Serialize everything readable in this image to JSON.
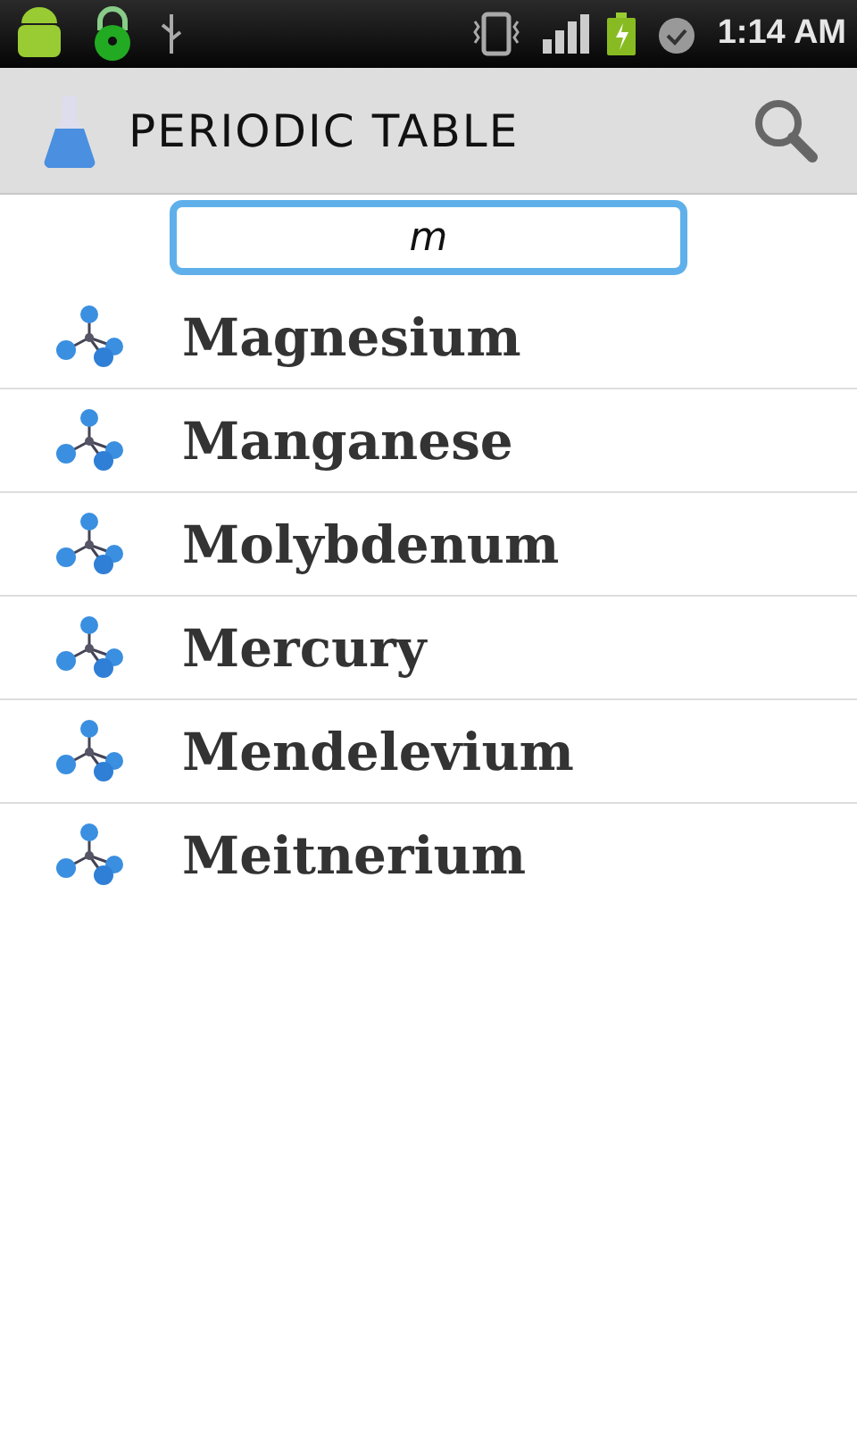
{
  "status_bar": {
    "time": "1:14 AM"
  },
  "app_bar": {
    "title": "PERIODIC TABLE"
  },
  "search": {
    "value": "m"
  },
  "elements": [
    {
      "name": "Magnesium"
    },
    {
      "name": "Manganese"
    },
    {
      "name": "Molybdenum"
    },
    {
      "name": "Mercury"
    },
    {
      "name": "Mendelevium"
    },
    {
      "name": "Meitnerium"
    }
  ]
}
